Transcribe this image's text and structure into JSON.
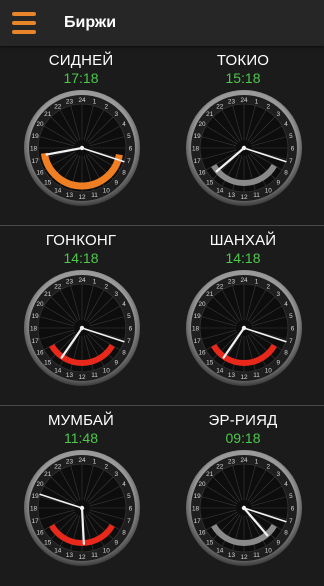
{
  "header": {
    "title": "Биржи",
    "menu_icon": "hamburger-menu-icon",
    "accent": "#e8852a"
  },
  "colors": {
    "time_green": "#4cc84a",
    "orange_arc": "#f07e22",
    "red_arc": "#e8281a",
    "gray_arc": "#8a8a8a"
  },
  "dial_labels": [
    "24",
    "1",
    "2",
    "3",
    "4",
    "5",
    "6",
    "7",
    "8",
    "9",
    "10",
    "11",
    "12",
    "13",
    "14",
    "15",
    "16",
    "17",
    "18",
    "19",
    "20",
    "21",
    "22",
    "23"
  ],
  "exchanges": [
    {
      "city": "СИДНЕЙ",
      "time": "17:18",
      "arc_color": "orange",
      "hour": 17,
      "minute": 18
    },
    {
      "city": "ТОКИО",
      "time": "15:18",
      "arc_color": "gray",
      "hour": 15,
      "minute": 18
    },
    {
      "city": "ГОНКОНГ",
      "time": "14:18",
      "arc_color": "red",
      "hour": 14,
      "minute": 18
    },
    {
      "city": "ШАНХАЙ",
      "time": "14:18",
      "arc_color": "red",
      "hour": 14,
      "minute": 18
    },
    {
      "city": "МУМБАЙ",
      "time": "11:48",
      "arc_color": "red",
      "hour": 11,
      "minute": 48
    },
    {
      "city": "ЭР-РИЯД",
      "time": "09:18",
      "arc_color": "gray",
      "hour": 9,
      "minute": 18
    }
  ]
}
